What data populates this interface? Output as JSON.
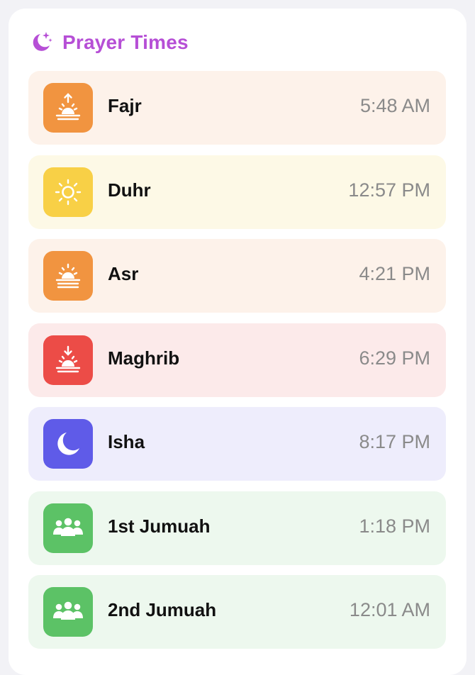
{
  "header": {
    "title": "Prayer Times",
    "icon": "moon-stars-icon",
    "accent_color": "#b64fd6"
  },
  "prayers": [
    {
      "name": "Fajr",
      "time": "5:48 AM",
      "icon": "sunrise-icon",
      "tile_color": "#f19440",
      "row_color": "#fdf2ea"
    },
    {
      "name": "Duhr",
      "time": "12:57 PM",
      "icon": "sun-icon",
      "tile_color": "#f8d046",
      "row_color": "#fdf9e6"
    },
    {
      "name": "Asr",
      "time": "4:21 PM",
      "icon": "sun-haze-icon",
      "tile_color": "#f19440",
      "row_color": "#fdf2ea"
    },
    {
      "name": "Maghrib",
      "time": "6:29 PM",
      "icon": "sunset-icon",
      "tile_color": "#ec4c47",
      "row_color": "#fceaea"
    },
    {
      "name": "Isha",
      "time": "8:17 PM",
      "icon": "moon-icon",
      "tile_color": "#5f5be8",
      "row_color": "#eeedfc"
    },
    {
      "name": "1st Jumuah",
      "time": "1:18 PM",
      "icon": "people-icon",
      "tile_color": "#5cc266",
      "row_color": "#edf8ee"
    },
    {
      "name": "2nd Jumuah",
      "time": "12:01 AM",
      "icon": "people-icon",
      "tile_color": "#5cc266",
      "row_color": "#edf8ee"
    }
  ]
}
